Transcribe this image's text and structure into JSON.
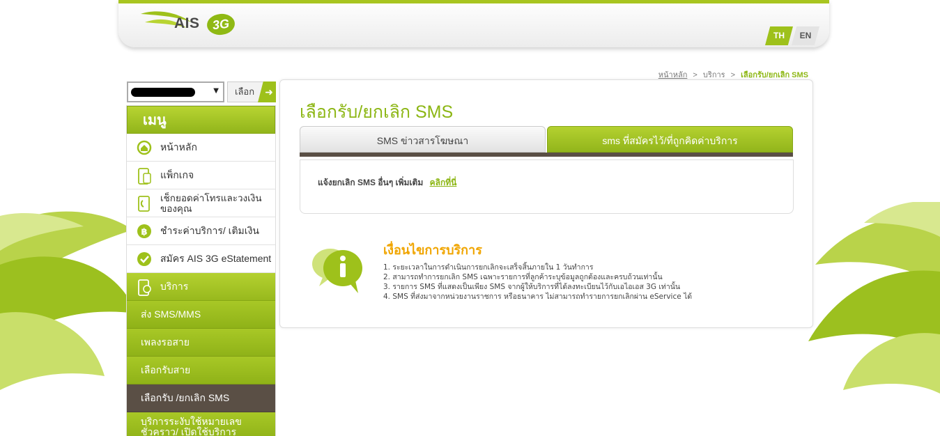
{
  "header": {
    "logo_text": "AIS",
    "logo_badge": "3G",
    "lang_th": "TH",
    "lang_en": "EN"
  },
  "breadcrumb": {
    "home": "หน้าหลัก",
    "services": "บริการ",
    "current": "เลือกรับ/ยกเลิก SMS",
    "separator": ">"
  },
  "number_select": {
    "button_label": "เลือก"
  },
  "sidebar": {
    "title": "เมนู",
    "items": [
      {
        "label": "หน้าหลัก",
        "icon": "home-icon"
      },
      {
        "label": "แพ็กเกจ",
        "icon": "phone-icon"
      },
      {
        "label": "เช็กยอดค่าโทรและวงเงิน ของคุณ",
        "icon": "bill-icon"
      },
      {
        "label": "ชำระค่าบริการ/ เติมเงิน",
        "icon": "baht-icon"
      },
      {
        "label": "สมัคร AIS 3G eStatement",
        "icon": "estatement-icon"
      },
      {
        "label": "บริการ",
        "icon": "service-icon"
      }
    ],
    "sub_items": [
      {
        "label": "ส่ง SMS/MMS"
      },
      {
        "label": "เพลงรอสาย"
      },
      {
        "label": "เลือกรับสาย"
      },
      {
        "label": "เลือกรับ /ยกเลิก SMS"
      },
      {
        "label": "บริการระงับใช้หมายเลขชั่วคราว/ เปิดใช้บริการหมายเลข"
      }
    ]
  },
  "main": {
    "title": "เลือกรับ/ยกเลิก SMS",
    "tabs": [
      {
        "label": "SMS ข่าวสารโฆษณา"
      },
      {
        "label": "sms ที่สมัครไว้/ที่ถูกคิดค่าบริการ"
      }
    ],
    "notice": "แจ้งยกเลิก SMS อื่นๆ เพิ่มเติม",
    "notice_link": "คลิกที่นี่",
    "conditions_title": "เงื่อนไขการบริการ",
    "conditions": [
      "1. ระยะเวลาในการดำเนินการยกเลิกจะเสร็จสิ้นภายใน 1 วันทำการ",
      "2. สามารถทำการยกเลิก SMS เฉพาะรายการที่ลูกค้าระบุข้อมูลถูกต้องและครบถ้วนเท่านั้น",
      "3. รายการ SMS ที่แสดงเป็นเพียง SMS จากผู้ให้บริการที่ได้ลงทะเบียนไว้กับเอไอเอส 3G เท่านั้น",
      "4. SMS ที่ส่งมาจากหน่วยงานราชการ หรือธนาคาร ไม่สามารถทำรายการยกเลิกผ่าน eService ได้"
    ]
  },
  "colors": {
    "brand_green": "#9ec11b",
    "selected_brown": "#5a4f45",
    "title_orange": "#f0a500"
  }
}
